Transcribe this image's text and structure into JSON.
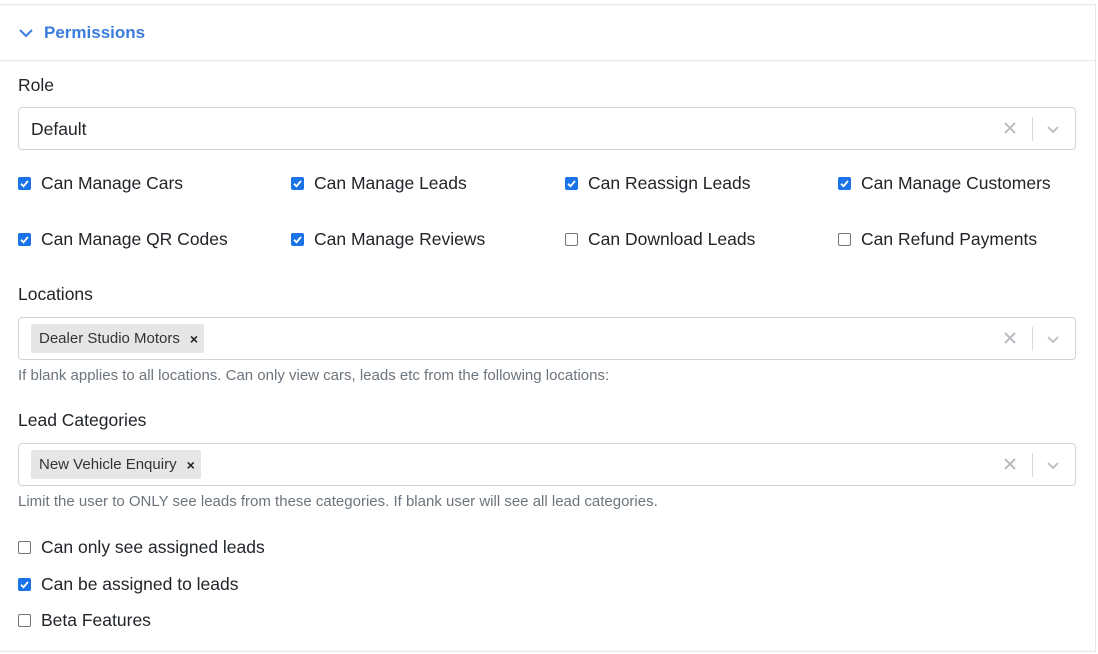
{
  "section": {
    "title": "Permissions"
  },
  "role": {
    "label": "Role",
    "value": "Default"
  },
  "permissions": [
    {
      "label": "Can Manage Cars",
      "checked": true
    },
    {
      "label": "Can Manage Leads",
      "checked": true
    },
    {
      "label": "Can Reassign Leads",
      "checked": true
    },
    {
      "label": "Can Manage Customers",
      "checked": true
    },
    {
      "label": "Can Manage QR Codes",
      "checked": true
    },
    {
      "label": "Can Manage Reviews",
      "checked": true
    },
    {
      "label": "Can Download Leads",
      "checked": false
    },
    {
      "label": "Can Refund Payments",
      "checked": false
    }
  ],
  "locations": {
    "label": "Locations",
    "chip": "Dealer Studio Motors",
    "help": "If blank applies to all locations. Can only view cars, leads etc from the following locations:"
  },
  "lead_categories": {
    "label": "Lead Categories",
    "chip": "New Vehicle Enquiry",
    "help": "Limit the user to ONLY see leads from these categories. If blank user will see all lead categories."
  },
  "options": [
    {
      "label": "Can only see assigned leads",
      "checked": false
    },
    {
      "label": "Can be assigned to leads",
      "checked": true
    },
    {
      "label": "Beta Features",
      "checked": false
    }
  ],
  "colors": {
    "accent": "#3b7ddd",
    "checkbox": "#1a73e8"
  },
  "icons": {
    "remove": "×"
  }
}
